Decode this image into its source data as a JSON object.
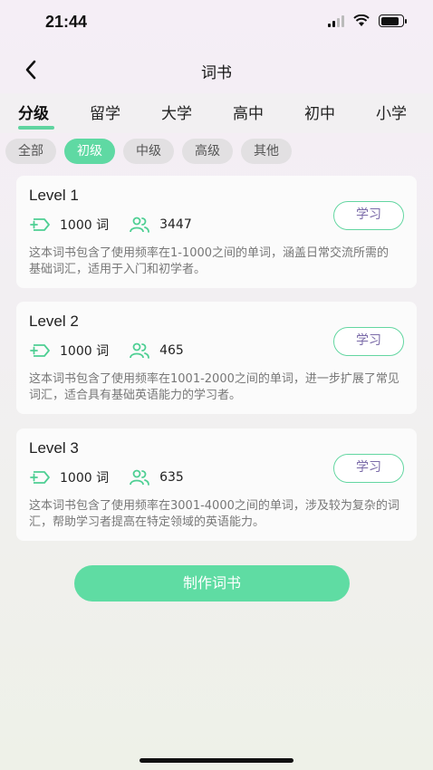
{
  "status_bar": {
    "time": "21:44",
    "battery_level": 0.85
  },
  "nav": {
    "title": "词书",
    "back_icon": "chevron-left-icon"
  },
  "tabs": [
    {
      "label": "分级",
      "active": true
    },
    {
      "label": "留学",
      "active": false
    },
    {
      "label": "大学",
      "active": false
    },
    {
      "label": "高中",
      "active": false
    },
    {
      "label": "初中",
      "active": false
    },
    {
      "label": "小学",
      "active": false
    }
  ],
  "filters": [
    {
      "label": "全部",
      "active": false
    },
    {
      "label": "初级",
      "active": true
    },
    {
      "label": "中级",
      "active": false
    },
    {
      "label": "高级",
      "active": false
    },
    {
      "label": "其他",
      "active": false
    }
  ],
  "books": [
    {
      "title": "Level 1",
      "word_count": "1000 词",
      "learners": "3447",
      "study_label": "学习",
      "description": "这本词书包含了使用频率在1-1000之间的单词，涵盖日常交流所需的基础词汇，适用于入门和初学者。"
    },
    {
      "title": "Level 2",
      "word_count": "1000 词",
      "learners": "465",
      "study_label": "学习",
      "description": "这本词书包含了使用频率在1001-2000之间的单词，进一步扩展了常见词汇，适合具有基础英语能力的学习者。"
    },
    {
      "title": "Level 3",
      "word_count": "1000 词",
      "learners": "635",
      "study_label": "学习",
      "description": "这本词书包含了使用频率在3001-4000之间的单词，涉及较为复杂的词汇，帮助学习者提高在特定领域的英语能力。"
    }
  ],
  "create_button_label": "制作词书",
  "colors": {
    "accent": "#5fd9a3",
    "study_text": "#7a6aa8"
  }
}
